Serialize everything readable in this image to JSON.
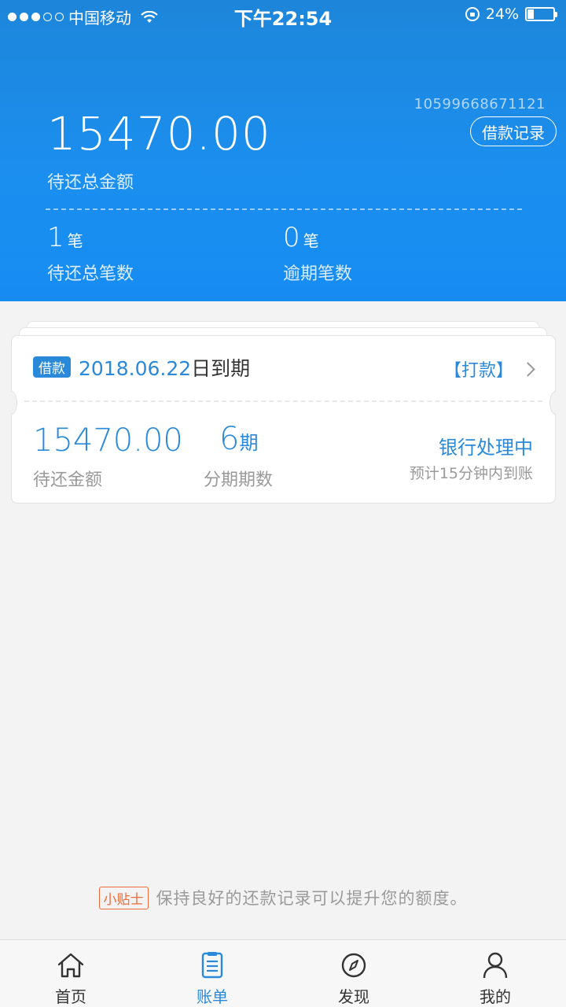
{
  "status_bar": {
    "carrier": "中国移动",
    "time": "下午22:54",
    "battery": "24%",
    "battery_level": 0.24
  },
  "header": {
    "account_number": "10599668671121",
    "loan_record_button": "借款记录",
    "total_amount": "15470.00",
    "total_amount_label": "待还总金额",
    "pending_count": "1",
    "pending_unit": "笔",
    "pending_label": "待还总笔数",
    "overdue_count": "0",
    "overdue_unit": "笔",
    "overdue_label": "逾期笔数"
  },
  "card": {
    "tag": "借款",
    "due_date": "2018.06.22",
    "due_suffix": "日到期",
    "pay_link": "【打款】",
    "amount": "15470.00",
    "amount_label": "待还金额",
    "term_count": "6",
    "term_unit": "期",
    "term_label": "分期期数",
    "status": "银行处理中",
    "status_sub": "预计15分钟内到账"
  },
  "tip": {
    "badge": "小贴士",
    "text": "保持良好的还款记录可以提升您的额度。"
  },
  "tabbar": {
    "tabs": [
      {
        "label": "首页",
        "icon": "home-icon"
      },
      {
        "label": "账单",
        "icon": "bill-icon"
      },
      {
        "label": "发现",
        "icon": "compass-icon"
      },
      {
        "label": "我的",
        "icon": "user-icon"
      }
    ],
    "active_index": 1
  },
  "colors": {
    "primary": "#2a8ad9",
    "header_bg": "#1b8ff0",
    "tip_accent": "#f06a3a"
  }
}
